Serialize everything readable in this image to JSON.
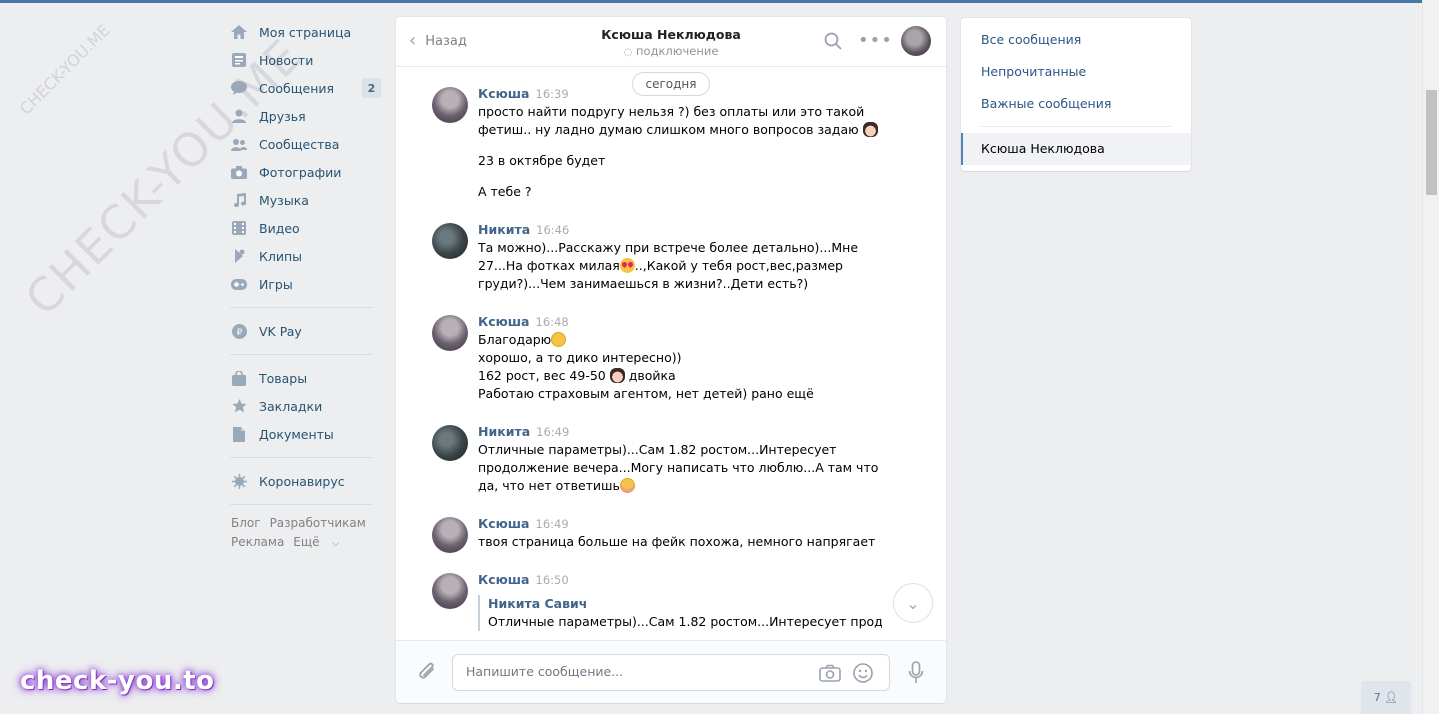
{
  "watermark": {
    "big": "CHECK-YOU.ME",
    "small": "CHECK-YOU.ME",
    "logo": "check-you.to"
  },
  "leftnav": {
    "items": [
      {
        "label": "Моя страница",
        "icon": "home-icon"
      },
      {
        "label": "Новости",
        "icon": "news-icon"
      },
      {
        "label": "Сообщения",
        "icon": "messages-icon",
        "badge": "2"
      },
      {
        "label": "Друзья",
        "icon": "friends-icon"
      },
      {
        "label": "Сообщества",
        "icon": "groups-icon"
      },
      {
        "label": "Фотографии",
        "icon": "camera-icon"
      },
      {
        "label": "Музыка",
        "icon": "music-icon"
      },
      {
        "label": "Видео",
        "icon": "video-icon"
      },
      {
        "label": "Клипы",
        "icon": "clips-icon"
      },
      {
        "label": "Игры",
        "icon": "gamepad-icon"
      }
    ],
    "pay": {
      "label": "VK Pay",
      "icon": "vkpay-icon"
    },
    "extra": [
      {
        "label": "Товары",
        "icon": "bag-icon"
      },
      {
        "label": "Закладки",
        "icon": "star-icon"
      },
      {
        "label": "Документы",
        "icon": "document-icon"
      }
    ],
    "corona": {
      "label": "Коронавирус",
      "icon": "virus-icon"
    },
    "footer": {
      "blog": "Блог",
      "dev": "Разработчикам",
      "ads": "Реклама",
      "more": "Ещё"
    }
  },
  "chat": {
    "back_label": "Назад",
    "title": "Ксюша Неклюдова",
    "status": "подключение",
    "date_divider": "сегодня",
    "messages": [
      {
        "author": "Ксюша",
        "time": "16:39",
        "avatar": "k",
        "lines": [
          "просто найти подругу нельзя ?) без оплаты или это такой",
          "фетиш.. ну ладно думаю слишком много вопросов задаю"
        ],
        "extra1": "23 в октябре будет",
        "extra2": "А тебе ?"
      },
      {
        "author": "Никита",
        "time": "16:46",
        "avatar": "n",
        "lines": [
          "Та можно)...Расскажу при встрече более детально)...Мне",
          "27...На фотках милая",
          "..,Какой у тебя рост,вес,размер",
          "груди?)...Чем занимаешься в жизни?..Дети есть?)"
        ]
      },
      {
        "author": "Ксюша",
        "time": "16:48",
        "avatar": "k",
        "lines": [
          "Благодарю",
          "хорошо, а то дико интересно))",
          "162 рост, вес 49-50",
          "двойка",
          "Работаю страховым агентом, нет детей) рано ещё"
        ]
      },
      {
        "author": "Никита",
        "time": "16:49",
        "avatar": "n",
        "lines": [
          "Отличные параметры)...Сам 1.82 ростом...Интересует",
          "продолжение вечера...Могу написать что люблю...А там что",
          "да, что нет ответишь"
        ]
      },
      {
        "author": "Ксюша",
        "time": "16:49",
        "avatar": "k",
        "lines": [
          "твоя страница больше на фейк похожа, немного напрягает"
        ]
      },
      {
        "author": "Ксюша",
        "time": "16:50",
        "avatar": "k",
        "quote_author": "Никита Савич",
        "quote_text": "Отличные параметры)...Сам 1.82 ростом...Интересует прод..."
      }
    ],
    "compose_placeholder": "Напишите сообщение..."
  },
  "rightpanel": {
    "all": "Все сообщения",
    "unread": "Непрочитанные",
    "important": "Важные сообщения",
    "active_chat": "Ксюша Неклюдова"
  },
  "online_count": "7"
}
